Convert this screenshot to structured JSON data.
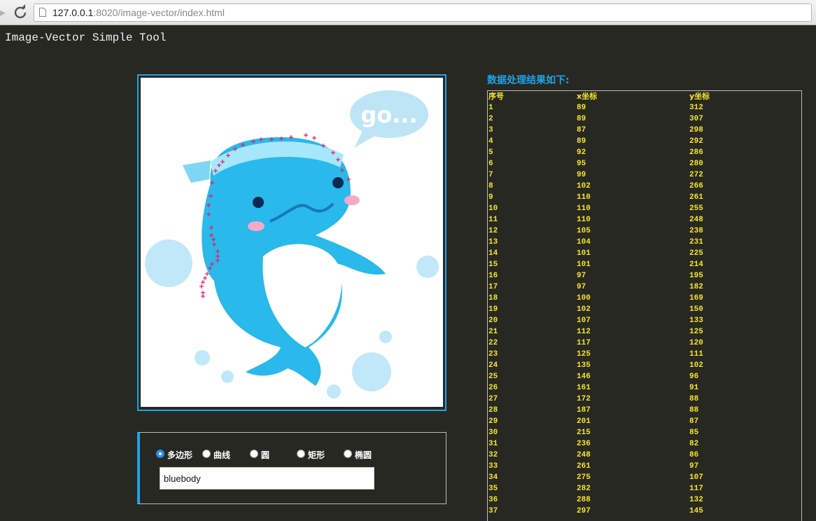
{
  "browser": {
    "url_host": "127.0.0.1",
    "url_rest": ":8020/image-vector/index.html"
  },
  "app": {
    "title": "Image-Vector Simple Tool"
  },
  "image": {
    "speech_bubble_text": "go..."
  },
  "shape_options": [
    {
      "label": "多边形",
      "checked": true
    },
    {
      "label": "曲线",
      "checked": false
    },
    {
      "label": "圆",
      "checked": false
    },
    {
      "label": "矩形",
      "checked": false
    },
    {
      "label": "椭圆",
      "checked": false
    }
  ],
  "name_input": {
    "value": "bluebody"
  },
  "results": {
    "heading": "数据处理结果如下:",
    "columns": [
      "序号",
      "x坐标",
      "y坐标"
    ],
    "rows": [
      [
        "1",
        "89",
        "312"
      ],
      [
        "2",
        "89",
        "307"
      ],
      [
        "3",
        "87",
        "298"
      ],
      [
        "4",
        "89",
        "292"
      ],
      [
        "5",
        "92",
        "286"
      ],
      [
        "6",
        "95",
        "280"
      ],
      [
        "7",
        "99",
        "272"
      ],
      [
        "8",
        "102",
        "266"
      ],
      [
        "9",
        "110",
        "261"
      ],
      [
        "10",
        "110",
        "255"
      ],
      [
        "11",
        "110",
        "248"
      ],
      [
        "12",
        "105",
        "238"
      ],
      [
        "13",
        "104",
        "231"
      ],
      [
        "14",
        "101",
        "225"
      ],
      [
        "15",
        "101",
        "214"
      ],
      [
        "16",
        "97",
        "195"
      ],
      [
        "17",
        "97",
        "182"
      ],
      [
        "18",
        "100",
        "169"
      ],
      [
        "19",
        "102",
        "150"
      ],
      [
        "20",
        "107",
        "133"
      ],
      [
        "21",
        "112",
        "125"
      ],
      [
        "22",
        "117",
        "120"
      ],
      [
        "23",
        "125",
        "111"
      ],
      [
        "24",
        "135",
        "102"
      ],
      [
        "25",
        "146",
        "96"
      ],
      [
        "26",
        "161",
        "91"
      ],
      [
        "27",
        "172",
        "88"
      ],
      [
        "28",
        "187",
        "88"
      ],
      [
        "29",
        "201",
        "87"
      ],
      [
        "30",
        "215",
        "85"
      ],
      [
        "31",
        "236",
        "82"
      ],
      [
        "32",
        "248",
        "86"
      ],
      [
        "33",
        "261",
        "97"
      ],
      [
        "34",
        "275",
        "107"
      ],
      [
        "35",
        "282",
        "117"
      ],
      [
        "36",
        "288",
        "132"
      ],
      [
        "37",
        "297",
        "145"
      ]
    ]
  },
  "colors": {
    "accent": "#1fa3e8",
    "table_text": "#f4e52c",
    "background": "#272822"
  }
}
